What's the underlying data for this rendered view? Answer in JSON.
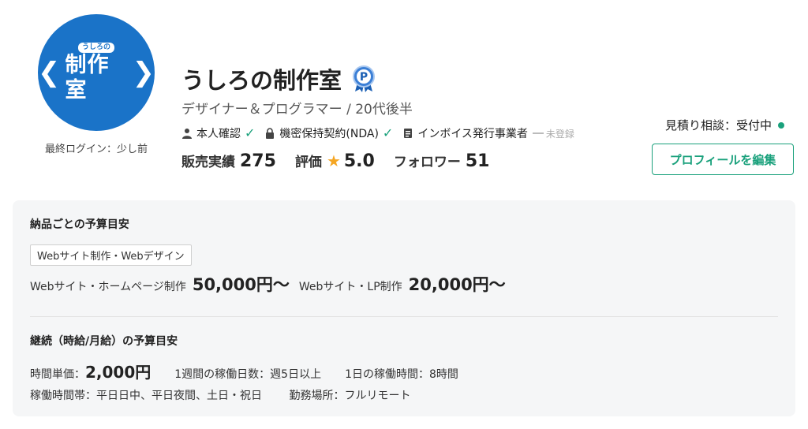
{
  "avatar": {
    "logo_small": "うしろの",
    "logo_main": "制作室",
    "logo_left": "❮",
    "logo_right": "❯",
    "color": "#1a73c8"
  },
  "last_login": "最終ログイン：少し前",
  "profile": {
    "name": "うしろの制作室",
    "badge_icon": "premium-badge-icon",
    "subtitle": "デザイナー＆プログラマー / 20代後半",
    "verifications": [
      {
        "label": "本人確認",
        "icon": "person-icon",
        "status": "✓"
      },
      {
        "label": "機密保持契約(NDA)",
        "icon": "lock-icon",
        "status": "✓"
      },
      {
        "label": "インボイス発行事業者",
        "icon": "document-icon",
        "status": "未登録"
      }
    ],
    "stats": {
      "sales_label": "販売実績",
      "sales_value": "275",
      "rating_label": "評価",
      "rating_value": "5.0",
      "followers_label": "フォロワー",
      "followers_value": "51"
    }
  },
  "estimate_status": "見積り相談：受付中",
  "edit_button": "プロフィールを編集",
  "budget": {
    "per_delivery_title": "納品ごとの予算目安",
    "category_tag": "Webサイト制作・Webデザイン",
    "items": [
      {
        "label": "Webサイト・ホームページ制作",
        "price": "50,000円〜"
      },
      {
        "label": "Webサイト・LP制作",
        "price": "20,000円〜"
      }
    ],
    "continuous_title": "継続（時給/月給）の予算目安",
    "hourly_label": "時間単価：",
    "hourly_value": "2,000円",
    "days_per_week": "1週間の稼働日数：週5日以上",
    "hours_per_day": "1日の稼働時間：8時間",
    "time_slots": "稼働時間帯：平日日中、平日夜間、土日・祝日",
    "work_location": "勤務場所：フルリモート"
  },
  "colors": {
    "accent": "#1aa17c",
    "star": "#f5a623",
    "avatar_bg": "#1a73c8"
  }
}
